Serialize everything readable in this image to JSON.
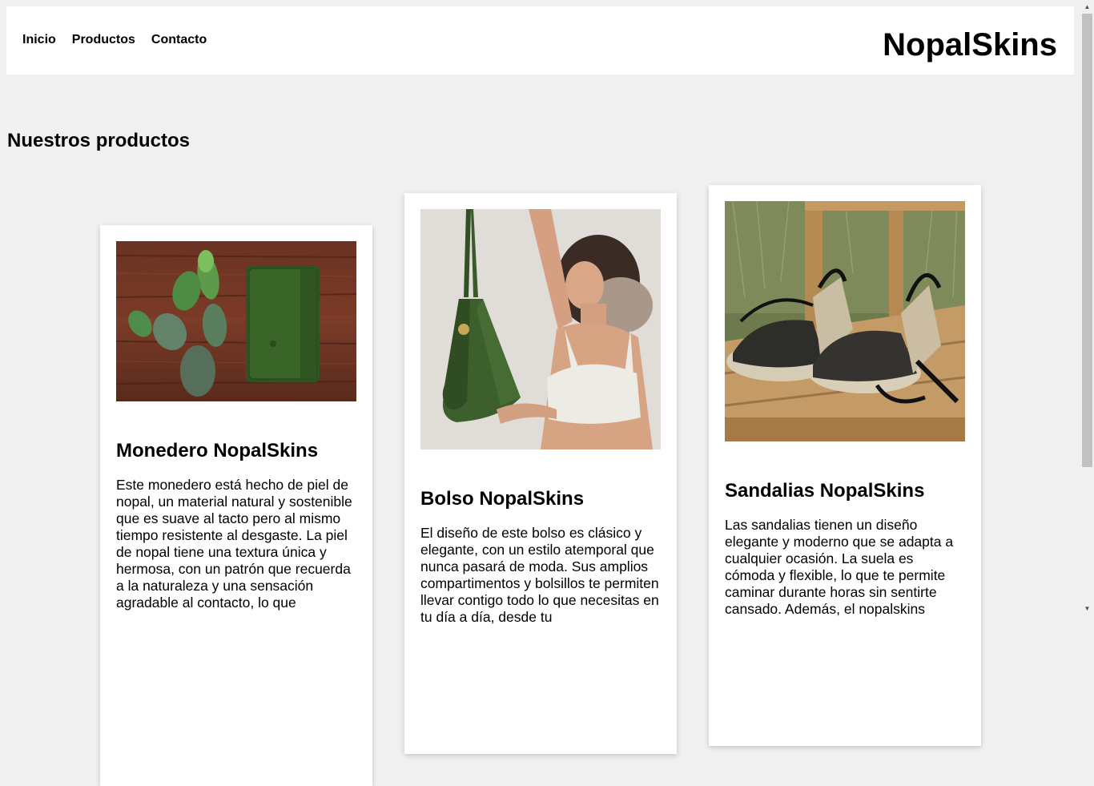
{
  "nav": {
    "items": [
      {
        "label": "Inicio"
      },
      {
        "label": "Productos"
      },
      {
        "label": "Contacto"
      }
    ]
  },
  "brand": "NopalSkins",
  "section_title": "Nuestros productos",
  "products": [
    {
      "title": "Monedero NopalSkins",
      "description": "Este monedero está hecho de piel de nopal, un material natural y sostenible que es suave al tacto pero al mismo tiempo resistente al desgaste. La piel de nopal tiene una textura única y hermosa, con un patrón que recuerda a la naturaleza y una sensación agradable al contacto, lo que",
      "image": "green-wallet-with-cactus-photo"
    },
    {
      "title": "Bolso NopalSkins",
      "description": "El diseño de este bolso es clásico y elegante, con un estilo atemporal que nunca pasará de moda. Sus amplios compartimentos y bolsillos te permiten llevar contigo todo lo que necesitas en tu día a día, desde tu",
      "image": "woman-holding-green-bag-photo"
    },
    {
      "title": "Sandalias NopalSkins",
      "description": "Las sandalias tienen un diseño elegante y moderno que se adapta a cualquier ocasión. La suela es cómoda y flexible, lo que te permite caminar durante horas sin sentirte cansado. Además, el nopalskins",
      "image": "espadrille-sandals-on-bench-photo"
    }
  ],
  "scrollbar": {
    "up_icon": "chevron-up-icon",
    "down_icon": "chevron-down-icon"
  }
}
